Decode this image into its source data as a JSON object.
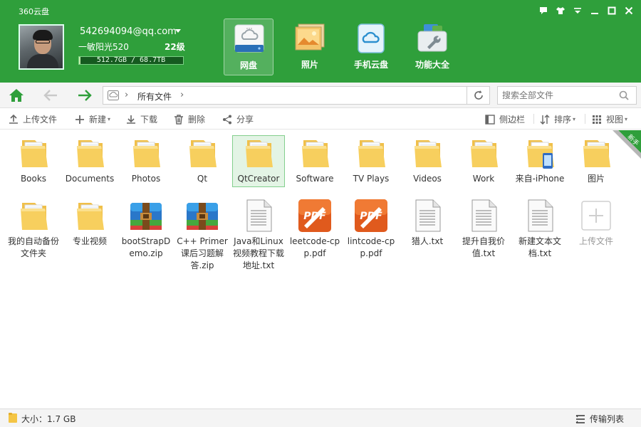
{
  "app": {
    "title": "360云盘"
  },
  "window_controls": {
    "icons": [
      "feedback-icon",
      "skin-icon",
      "menu-icon",
      "minimize-icon",
      "maximize-icon",
      "close-icon"
    ]
  },
  "user": {
    "account": "542694094@qq.com",
    "nickname": "一敏阳光520",
    "level": "22级",
    "quota_text": "512.7GB / 68.7TB",
    "quota_used_fraction": 0.007
  },
  "nav": {
    "items": [
      {
        "label": "网盘",
        "icon": "cloud-disk-icon",
        "active": true
      },
      {
        "label": "照片",
        "icon": "photo-icon",
        "active": false
      },
      {
        "label": "手机云盘",
        "icon": "phone-cloud-icon",
        "active": false
      },
      {
        "label": "功能大全",
        "icon": "toolbox-icon",
        "active": false
      }
    ]
  },
  "address": {
    "breadcrumb": "所有文件",
    "search_placeholder": "搜索全部文件"
  },
  "toolbar": {
    "upload": "上传文件",
    "new": "新建",
    "download": "下载",
    "delete": "删除",
    "share": "分享",
    "sidebar": "侧边栏",
    "sort": "排序",
    "view": "视图"
  },
  "badge": {
    "label": "新手"
  },
  "files": [
    {
      "name": "Books",
      "type": "folder"
    },
    {
      "name": "Documents",
      "type": "folder"
    },
    {
      "name": "Photos",
      "type": "folder"
    },
    {
      "name": "Qt",
      "type": "folder"
    },
    {
      "name": "QtCreator",
      "type": "folder",
      "selected": true
    },
    {
      "name": "Software",
      "type": "folder"
    },
    {
      "name": "TV Plays",
      "type": "folder"
    },
    {
      "name": "Videos",
      "type": "folder"
    },
    {
      "name": "Work",
      "type": "folder"
    },
    {
      "name": "来自-iPhone",
      "type": "folder-phone"
    },
    {
      "name": "图片",
      "type": "folder"
    },
    {
      "name": "我的自动备份文件夹",
      "type": "folder"
    },
    {
      "name": "专业视频",
      "type": "folder"
    },
    {
      "name": "bootStrapDemo.zip",
      "type": "zip"
    },
    {
      "name": "C++ Primer课后习题解答.zip",
      "type": "zip"
    },
    {
      "name": "Java和Linux视频教程下载地址.txt",
      "type": "txt"
    },
    {
      "name": "leetcode-cpp.pdf",
      "type": "pdf"
    },
    {
      "name": "lintcode-cpp.pdf",
      "type": "pdf"
    },
    {
      "name": "猎人.txt",
      "type": "txt"
    },
    {
      "name": "提升自我价值.txt",
      "type": "txt"
    },
    {
      "name": "新建文本文档.txt",
      "type": "txt"
    },
    {
      "name": "上传文件",
      "type": "upload"
    }
  ],
  "status": {
    "size": "大小：1.7 GB",
    "transfer_list": "传输列表"
  },
  "colors": {
    "header_green": "#2f9f3b",
    "accent_green": "#2f9f3b",
    "selection": "#e3f4e5"
  }
}
